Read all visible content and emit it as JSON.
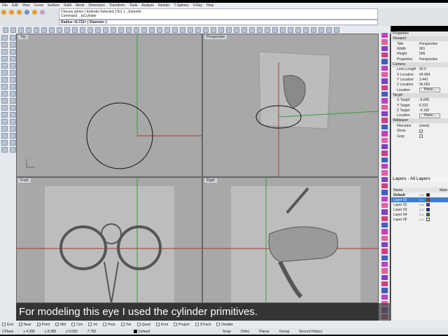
{
  "menu": [
    "File",
    "Edit",
    "View",
    "Curve",
    "Surface",
    "Solid",
    "Mesh",
    "Dimension",
    "Transform",
    "Tools",
    "Analyze",
    "Render",
    "T-Splines",
    "V-Ray",
    "Help"
  ],
  "command": {
    "history": [
      "Choose option ( Extends Selected 1To1 ): _Extends",
      "Command: _tsCylinder"
    ],
    "prompt": "Radius <6.732> ( Diameter ):"
  },
  "viewports": [
    {
      "title": "Top"
    },
    {
      "title": "Perspective"
    },
    {
      "title": "Front"
    },
    {
      "title": "Right"
    }
  ],
  "properties": {
    "title": "Properties",
    "section_viewport": "Viewport",
    "viewport": [
      [
        "Title",
        "Perspective"
      ],
      [
        "Width",
        "661"
      ],
      [
        "Height",
        "506"
      ],
      [
        "Projection",
        "Perspective"
      ]
    ],
    "section_camera": "Camera",
    "camera": [
      [
        "Lens Length",
        "50.0"
      ],
      [
        "X Location",
        "64.904"
      ],
      [
        "Y Location",
        "3.441"
      ],
      [
        "Z Location",
        "56.652"
      ]
    ],
    "location_label": "Location",
    "place": "Place...",
    "section_target": "Target",
    "target": [
      [
        "X Target",
        "-6.005"
      ],
      [
        "Y Target",
        "6.322"
      ],
      [
        "Z Target",
        "-0.150"
      ]
    ],
    "section_wallpaper": "Wallpaper",
    "filename_label": "Filename",
    "filename": "(none)",
    "show_label": "Show",
    "gray_label": "Gray"
  },
  "layers": {
    "title": "Layers - All Layers",
    "col_name": "Name",
    "col_mat": "Mate",
    "items": [
      {
        "name": "Default",
        "color": "#000000"
      },
      {
        "name": "Layer 01",
        "color": "#e02020"
      },
      {
        "name": "Layer 02",
        "color": "#6a20c0"
      },
      {
        "name": "Layer 03",
        "color": "#2020c0"
      },
      {
        "name": "Layer 04",
        "color": "#208020"
      },
      {
        "name": "Layer 05",
        "color": "#ffffff"
      }
    ]
  },
  "caption": "For modeling this eye I used the cylinder primitives.",
  "osnaps": [
    [
      "End",
      false
    ],
    [
      "Near",
      true
    ],
    [
      "Point",
      true
    ],
    [
      "Mid",
      true
    ],
    [
      "Cen",
      false
    ],
    [
      "Int",
      false
    ],
    [
      "Perp",
      false
    ],
    [
      "Tan",
      false
    ],
    [
      "Quad",
      false
    ],
    [
      "Knot",
      false
    ],
    [
      "Project",
      false
    ],
    [
      "STrack",
      false
    ],
    [
      "Disable",
      false
    ]
  ],
  "status": {
    "cplane": "CPlane",
    "x": "x 4.285",
    "y": "y 8.385",
    "z": "z 0.000",
    "d": "7.760",
    "layer": "Default",
    "toggles": [
      "Snap",
      "Ortho",
      "Planar",
      "Osnap",
      "Record History"
    ]
  }
}
